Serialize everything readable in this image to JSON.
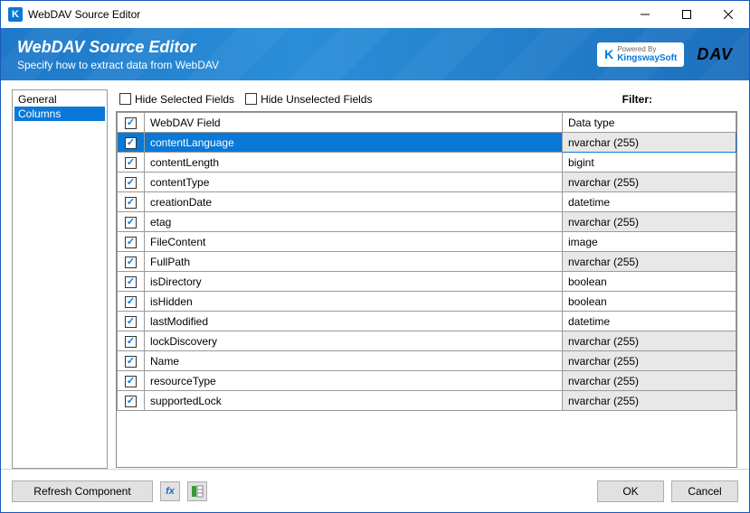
{
  "window": {
    "title": "WebDAV Source Editor"
  },
  "banner": {
    "title": "WebDAV Source Editor",
    "subtitle": "Specify how to extract data from WebDAV",
    "logo_powered": "Powered By",
    "logo_brand": "KingswaySoft",
    "logo_dav": "DAV"
  },
  "sidebar": {
    "items": [
      {
        "label": "General",
        "selected": false
      },
      {
        "label": "Columns",
        "selected": true
      }
    ]
  },
  "toolbar": {
    "hide_selected_label": "Hide Selected Fields",
    "hide_selected_checked": false,
    "hide_unselected_label": "Hide Unselected Fields",
    "hide_unselected_checked": false,
    "filter_label": "Filter:",
    "filter_value": ""
  },
  "table": {
    "headers": {
      "field": "WebDAV Field",
      "type": "Data type"
    },
    "header_checked": true,
    "rows": [
      {
        "checked": true,
        "field": "contentLanguage",
        "type": "nvarchar (255)",
        "selected": true,
        "shaded": true
      },
      {
        "checked": true,
        "field": "contentLength",
        "type": "bigint",
        "selected": false,
        "shaded": false
      },
      {
        "checked": true,
        "field": "contentType",
        "type": "nvarchar (255)",
        "selected": false,
        "shaded": true
      },
      {
        "checked": true,
        "field": "creationDate",
        "type": "datetime",
        "selected": false,
        "shaded": false
      },
      {
        "checked": true,
        "field": "etag",
        "type": "nvarchar (255)",
        "selected": false,
        "shaded": true
      },
      {
        "checked": true,
        "field": "FileContent",
        "type": "image",
        "selected": false,
        "shaded": false
      },
      {
        "checked": true,
        "field": "FullPath",
        "type": "nvarchar (255)",
        "selected": false,
        "shaded": true
      },
      {
        "checked": true,
        "field": "isDirectory",
        "type": "boolean",
        "selected": false,
        "shaded": false
      },
      {
        "checked": true,
        "field": "isHidden",
        "type": "boolean",
        "selected": false,
        "shaded": false
      },
      {
        "checked": true,
        "field": "lastModified",
        "type": "datetime",
        "selected": false,
        "shaded": false
      },
      {
        "checked": true,
        "field": "lockDiscovery",
        "type": "nvarchar (255)",
        "selected": false,
        "shaded": true
      },
      {
        "checked": true,
        "field": "Name",
        "type": "nvarchar (255)",
        "selected": false,
        "shaded": true
      },
      {
        "checked": true,
        "field": "resourceType",
        "type": "nvarchar (255)",
        "selected": false,
        "shaded": true
      },
      {
        "checked": true,
        "field": "supportedLock",
        "type": "nvarchar (255)",
        "selected": false,
        "shaded": true
      }
    ]
  },
  "footer": {
    "refresh_label": "Refresh Component",
    "fx_icon": "fx",
    "props_icon": "props",
    "ok_label": "OK",
    "cancel_label": "Cancel"
  }
}
